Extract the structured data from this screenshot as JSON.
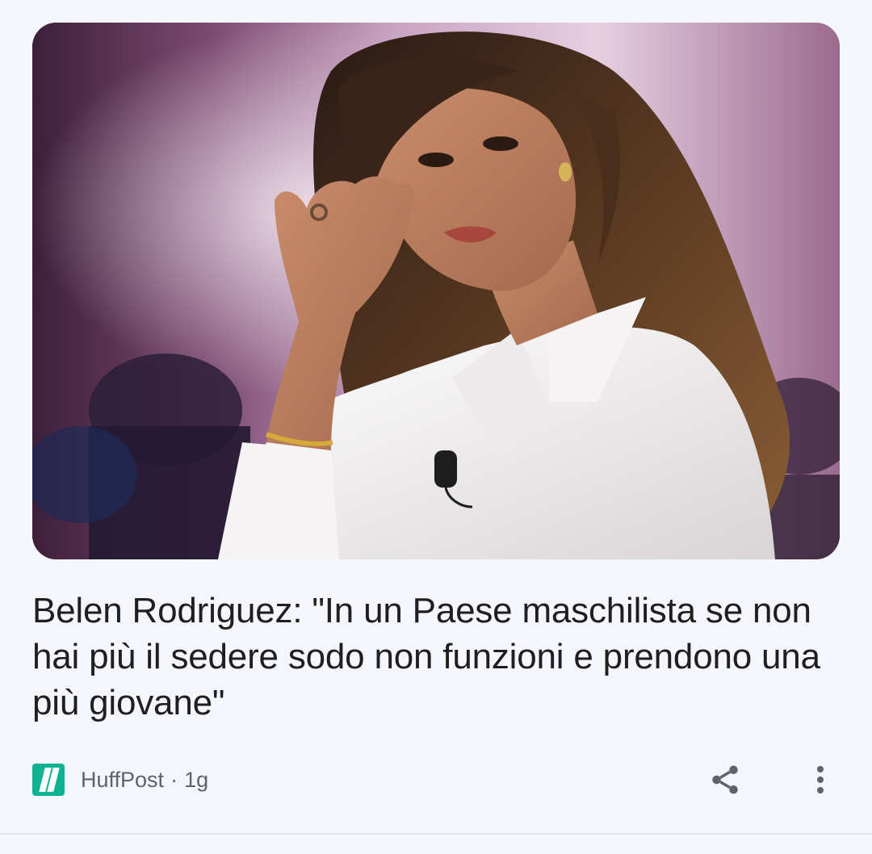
{
  "article": {
    "headline": "Belen Rodriguez: \"In un Paese maschilista se non hai più il sedere sodo non funzioni e prendono una più giovane\"",
    "image_description_name": "hero-photo"
  },
  "source": {
    "name": "HuffPost",
    "separator": "·",
    "age": "1g",
    "logo_color": "#0fb394"
  },
  "actions": {
    "share_icon": "share-icon",
    "more_icon": "more-vertical-icon"
  },
  "colors": {
    "background": "#f4f6fb",
    "headline": "#1f1f1f",
    "meta": "#5f6368",
    "icon": "#5f6368"
  }
}
